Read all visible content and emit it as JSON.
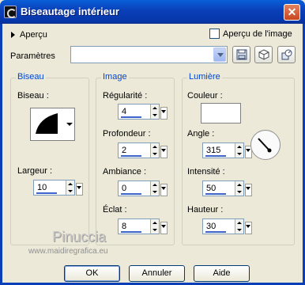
{
  "window": {
    "title": "Biseautage intérieur",
    "close_label": "✕"
  },
  "preview": {
    "label": "Aperçu",
    "checkbox_label": "Aperçu de l'image",
    "checkbox_checked": false
  },
  "params": {
    "label": "Paramètres",
    "value": ""
  },
  "groups": {
    "biseau": {
      "title": "Biseau",
      "bevel_label": "Biseau :",
      "largeur_label": "Largeur :",
      "largeur_value": "10"
    },
    "image": {
      "title": "Image",
      "regularite_label": "Régularité :",
      "regularite_value": "4",
      "profondeur_label": "Profondeur :",
      "profondeur_value": "2",
      "ambiance_label": "Ambiance :",
      "ambiance_value": "0",
      "eclat_label": "Éclat :",
      "eclat_value": "8"
    },
    "lumiere": {
      "title": "Lumière",
      "couleur_label": "Couleur :",
      "couleur": "#ffffff",
      "angle_label": "Angle :",
      "angle_value": "315",
      "intensite_label": "Intensité :",
      "intensite_value": "50",
      "hauteur_label": "Hauteur :",
      "hauteur_value": "30"
    }
  },
  "watermark": {
    "name": "Pinuccia",
    "url": "www.maidiregrafica.eu"
  },
  "buttons": {
    "ok": "OK",
    "annuler": "Annuler",
    "aide": "Aide"
  },
  "icons": [
    "app-icon",
    "arrow-right-icon",
    "save-preset-icon",
    "reset-icon",
    "preset-options-icon"
  ]
}
